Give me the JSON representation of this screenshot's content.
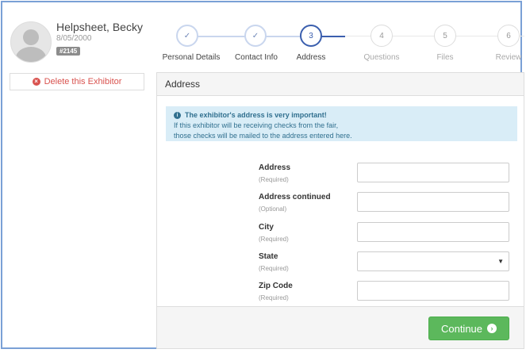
{
  "profile": {
    "name": "Helpsheet, Becky",
    "date": "8/05/2000",
    "id_badge": "#2145",
    "delete_label": "Delete this Exhibitor"
  },
  "steps": [
    {
      "label": "Personal Details",
      "marker": "✓",
      "state": "done"
    },
    {
      "label": "Contact Info",
      "marker": "✓",
      "state": "done"
    },
    {
      "label": "Address",
      "marker": "3",
      "state": "active"
    },
    {
      "label": "Questions",
      "marker": "4",
      "state": "pending"
    },
    {
      "label": "Files",
      "marker": "5",
      "state": "pending"
    },
    {
      "label": "Review",
      "marker": "6",
      "state": "pending"
    }
  ],
  "panel": {
    "title": "Address",
    "alert": {
      "title": "The exhibitor's address is very important!",
      "line1": "If this exhibitor will be receiving checks from the fair,",
      "line2": "those checks will be mailed to the address entered here."
    },
    "fields": [
      {
        "label": "Address",
        "sub": "(Required)",
        "value": ""
      },
      {
        "label": "Address continued",
        "sub": "(Optional)",
        "value": ""
      },
      {
        "label": "City",
        "sub": "(Required)",
        "value": ""
      },
      {
        "label": "State",
        "sub": "(Required)",
        "value": ""
      },
      {
        "label": "Zip Code",
        "sub": "(Required)",
        "value": ""
      }
    ],
    "continue_label": "Continue"
  },
  "icons": {
    "delete": "times-circle-icon",
    "info": "info-circle-icon",
    "continue": "arrow-circle-right-icon",
    "select": "caret-down-icon"
  },
  "colors": {
    "accent": "#3b5fae",
    "success": "#5cb85c",
    "danger": "#d9534f",
    "info_bg": "#d9edf7",
    "info_text": "#31708f"
  }
}
